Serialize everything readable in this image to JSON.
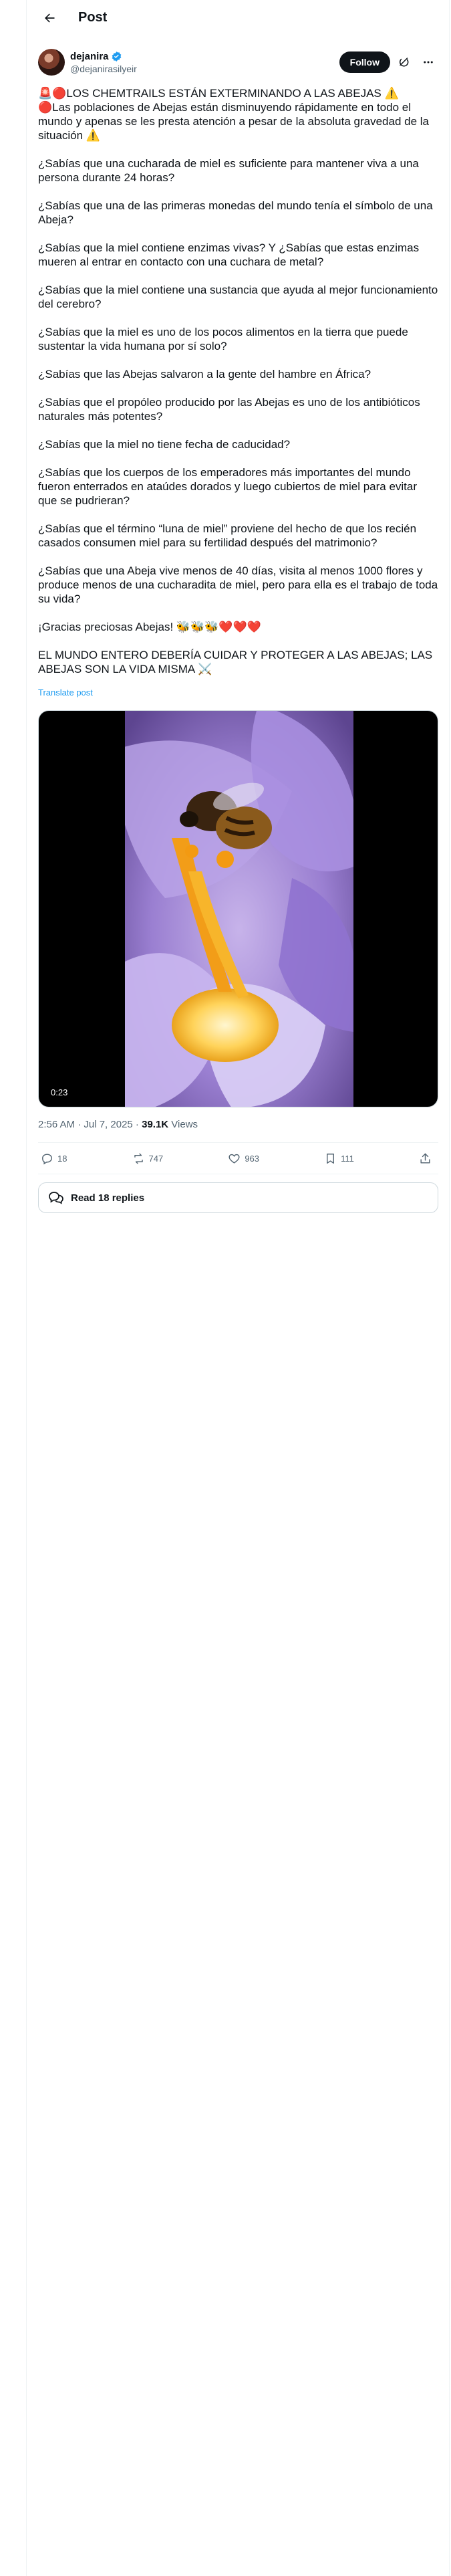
{
  "header": {
    "title": "Post"
  },
  "author": {
    "name": "dejanira",
    "handle": "@dejanirasilyeir",
    "follow_label": "Follow"
  },
  "post": {
    "paragraphs": [
      "🚨🔴LOS CHEMTRAILS ESTÁN EXTERMINANDO A LAS  ABEJAS ⚠️\n🔴Las poblaciones de Abejas están disminuyendo rápidamente en todo el mundo y apenas se les presta atención a pesar de la absoluta gravedad de la situación ⚠️",
      "¿Sabías que una cucharada de miel es suficiente para mantener viva a una persona durante 24 horas?",
      "¿Sabías que una de las primeras monedas del mundo tenía el símbolo de una Abeja?",
      "¿Sabías que la miel contiene enzimas vivas? Y ¿Sabías que estas enzimas mueren al entrar en contacto con una cuchara de metal?",
      "¿Sabías que la miel contiene una sustancia que ayuda al mejor funcionamiento del cerebro?",
      "¿Sabías que la miel es uno de los pocos alimentos en la tierra que puede sustentar la vida humana por sí solo?",
      "¿Sabías que las Abejas salvaron a la gente del hambre en África?",
      "¿Sabías que el propóleo producido por las Abejas es uno de los antibióticos naturales más potentes?",
      "¿Sabías que la miel no tiene fecha de caducidad?",
      "¿Sabías que los cuerpos de los emperadores más importantes del mundo fueron enterrados en ataúdes dorados y luego cubiertos de miel para evitar que se pudrieran?",
      "¿Sabías que el término “luna de miel” proviene del hecho de que los recién casados consumen miel para su fertilidad después del matrimonio?",
      "¿Sabías que una Abeja vive menos de 40 días, visita al menos 1000 flores y produce menos de una cucharadita de miel, pero para ella es el trabajo de toda su vida?",
      "¡Gracias preciosas Abejas! 🐝🐝🐝❤️❤️❤️",
      "EL MUNDO ENTERO DEBERÍA CUIDAR Y PROTEGER A LAS ABEJAS; LAS ABEJAS SON LA VIDA MISMA ⚔️"
    ],
    "translate_label": "Translate post",
    "video_duration": "0:23",
    "timestamp": "2:56 AM · Jul 7, 2025",
    "separator": " · ",
    "views_count": "39.1K",
    "views_label": " Views"
  },
  "stats": {
    "replies": "18",
    "reposts": "747",
    "likes": "963",
    "bookmarks": "111"
  },
  "read_replies_label": "Read 18 replies",
  "colors": {
    "accent": "#1d9bf0",
    "text": "#0f1419",
    "secondary": "#536471",
    "border": "#eff3f4"
  }
}
